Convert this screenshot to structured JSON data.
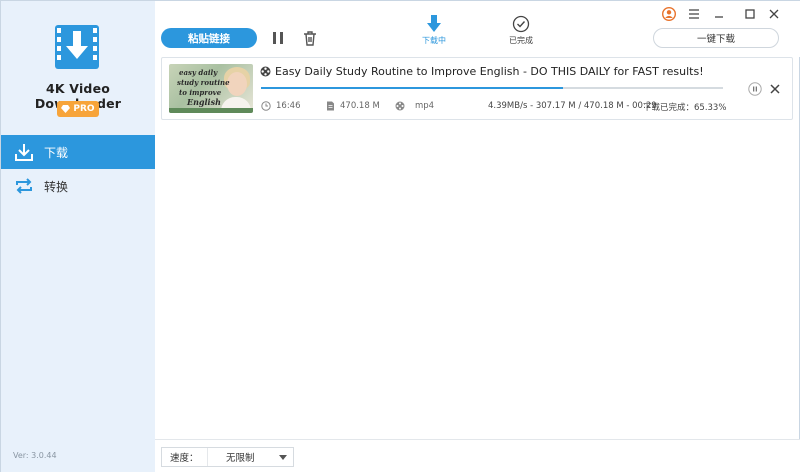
{
  "app": {
    "name": "4K Video Downloader",
    "badge": "PRO",
    "version": "Ver: 3.0.44",
    "accent_color": "#2c97dd",
    "badge_color": "#f7a43a"
  },
  "sidebar": {
    "items": [
      {
        "label": "下载",
        "icon": "download-icon",
        "active": true
      },
      {
        "label": "转换",
        "icon": "convert-icon",
        "active": false
      }
    ]
  },
  "toolbar": {
    "paste_link_label": "粘贴链接",
    "pause_icon": "pause-all-icon",
    "delete_icon": "trash-icon",
    "tabs": [
      {
        "label": "下载中",
        "icon": "downloading-arrow-icon",
        "active": true
      },
      {
        "label": "已完成",
        "icon": "check-circle-icon",
        "active": false
      }
    ],
    "one_click_label": "一键下载"
  },
  "window_controls": [
    "account-icon",
    "menu-icon",
    "minimize-icon",
    "maximize-icon",
    "close-icon"
  ],
  "download": {
    "title": "Easy Daily Study Routine to Improve English - DO THIS DAILY for FAST results!",
    "thumbnail_text": [
      "easy daily",
      "study routine",
      "to improve",
      "English"
    ],
    "duration": "16:46",
    "size": "470.18 M",
    "format": "mp4",
    "speed_status": "4.39MB/s - 307.17 M / 470.18 M - 00:29",
    "progress_text": "下载已完成：65.33%",
    "progress": 0.6533
  },
  "bottom": {
    "speed_label": "速度：",
    "speed_value": "无限制"
  }
}
